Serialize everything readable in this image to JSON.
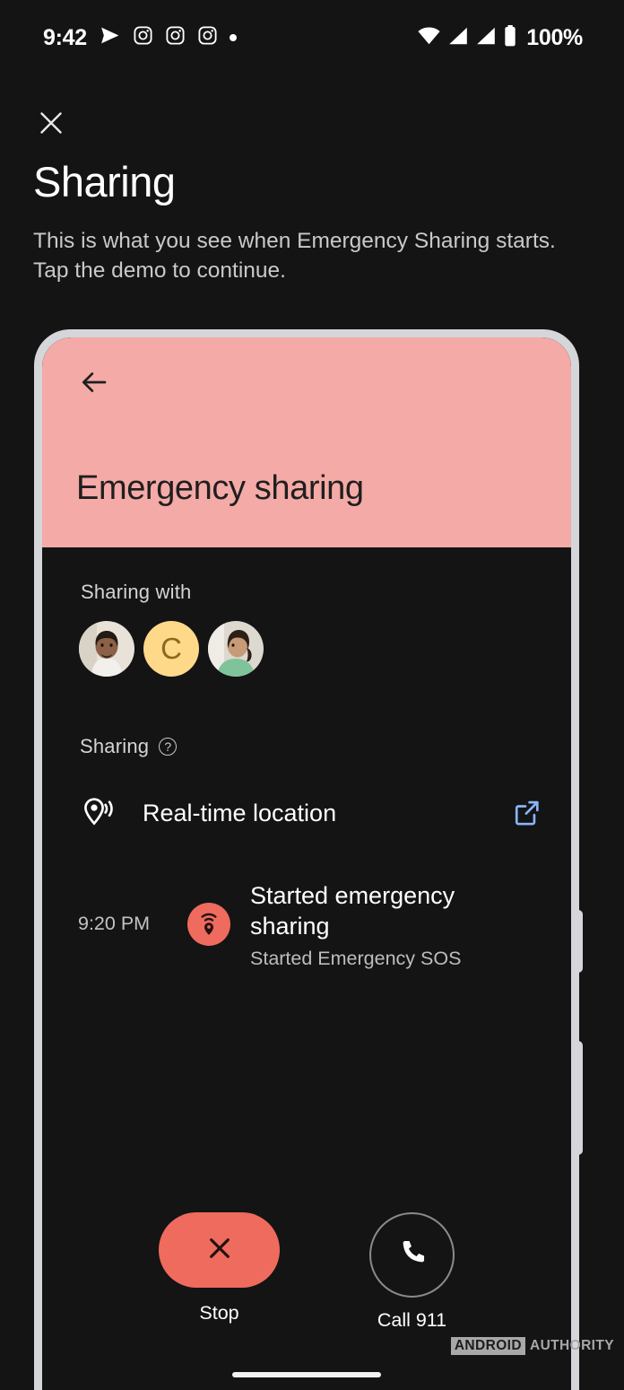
{
  "status_bar": {
    "time": "9:42",
    "battery_percent": "100%",
    "left_icons": [
      "send-icon",
      "instagram-icon",
      "instagram-icon",
      "instagram-icon",
      "more-notifications-dot-icon"
    ],
    "right_icons": [
      "wifi-icon",
      "signal-icon",
      "signal-icon",
      "battery-icon"
    ]
  },
  "header": {
    "close_icon": "close-icon",
    "title": "Sharing",
    "subtitle": "This is what you see when Emergency Sharing starts. Tap the demo to continue."
  },
  "phone_demo": {
    "hero": {
      "back_icon": "back-arrow-icon",
      "title": "Emergency sharing",
      "background_color": "#f4aaa6"
    },
    "sharing_with": {
      "label": "Sharing with",
      "contacts": [
        {
          "type": "photo",
          "name": "contact-photo-1",
          "description": "man in white shirt"
        },
        {
          "type": "initial",
          "name": "contact-initial-c",
          "initial": "C",
          "color": "#ffd98a"
        },
        {
          "type": "photo",
          "name": "contact-photo-3",
          "description": "woman in green top"
        }
      ]
    },
    "sharing_section": {
      "label": "Sharing",
      "help_icon": "help-circle-icon",
      "items": [
        {
          "icon": "location-broadcast-icon",
          "label": "Real-time location",
          "action_icon": "external-link-icon",
          "action_color": "#8ab4f8"
        }
      ]
    },
    "timeline": [
      {
        "time": "9:20 PM",
        "badge_icon": "emergency-location-icon",
        "badge_color": "#ee6b5e",
        "title": "Started emergency sharing",
        "subtitle": "Started Emergency SOS"
      }
    ],
    "actions": [
      {
        "icon": "close-icon",
        "label": "Stop",
        "style": "filled",
        "color": "#ee6b5e"
      },
      {
        "icon": "phone-icon",
        "label": "Call 911",
        "style": "outlined"
      }
    ],
    "nav_indicator": "home-indicator"
  },
  "watermark": {
    "first": "ANDROID",
    "second": "AUTHORITY"
  }
}
